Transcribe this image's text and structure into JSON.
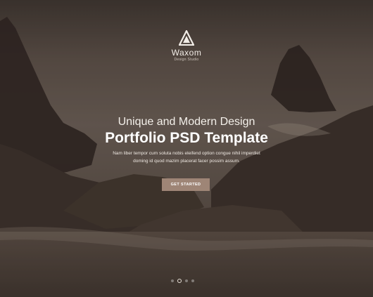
{
  "logo": {
    "icon": "triangle-logo-icon",
    "name": "Waxom",
    "tagline": "Design Studio"
  },
  "hero": {
    "kicker": "Unique and Modern Design",
    "headline": "Portfolio PSD Template",
    "description": "Nam liber tempor cum soluta nobis eleifend option congue nihil imperdiet doming id quod mazim placerat facer possim assum.",
    "cta_label": "GET STARTED"
  },
  "slider": {
    "slide_count": 4,
    "active_slide": 2
  },
  "colors": {
    "accent": "#9e8576",
    "text": "#ffffff"
  }
}
